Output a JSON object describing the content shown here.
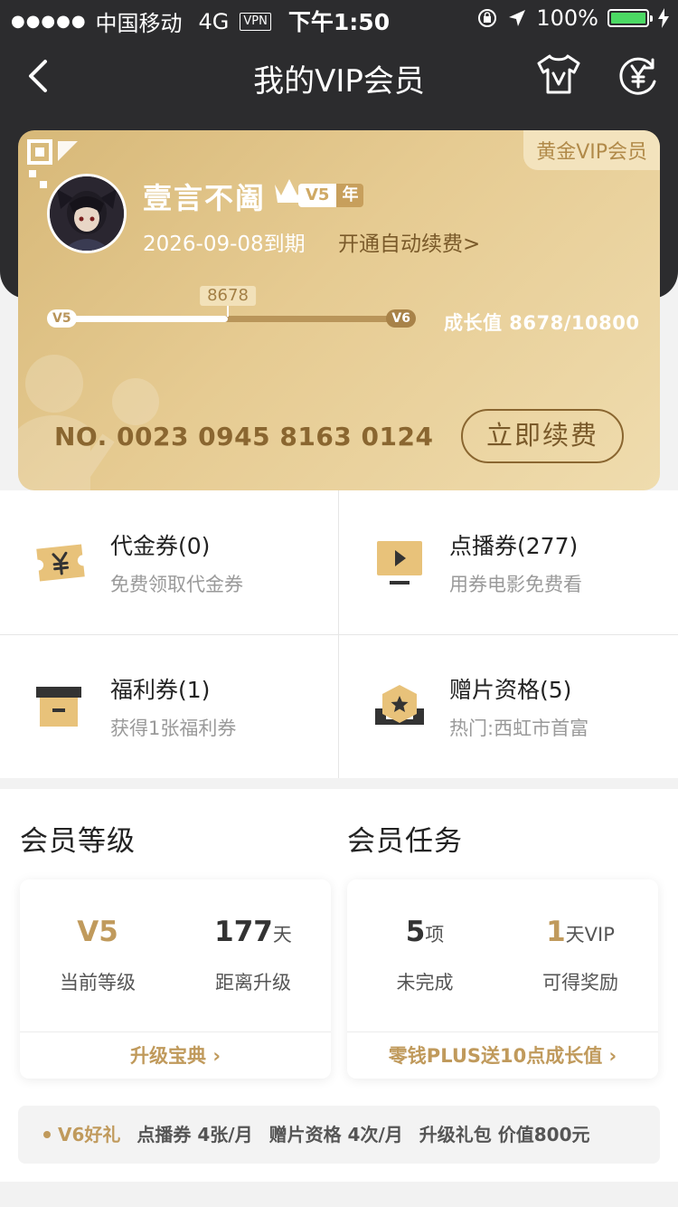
{
  "status_bar": {
    "signal_dots": "●●●●●",
    "carrier": "中国移动",
    "network": "4G",
    "vpn": "VPN",
    "time": "下午1:50",
    "battery": "100%"
  },
  "nav": {
    "title": "我的VIP会员",
    "icons": [
      "back-arrow-icon",
      "tshirt-icon",
      "yen-refresh-icon"
    ]
  },
  "card": {
    "tier_badge": "黄金VIP会员",
    "username": "壹言不阖",
    "level": "V5",
    "level_suffix": "年",
    "expire": "2026-09-08到期",
    "auto_renew": "开通自动续费>",
    "progress": {
      "current": 8678,
      "total": 10800,
      "current_label": "8678",
      "start_level": "V5",
      "end_level": "V6",
      "growth_text": "成长值 8678/10800"
    },
    "card_no": "NO. 0023 0945 8163 0124",
    "renew_button": "立即续费",
    "colors": {
      "gold_dark": "#8a6630",
      "gold": "#c09a5c"
    }
  },
  "benefits": [
    {
      "title": "代金券(0)",
      "subtitle": "免费领取代金券",
      "icon": "voucher-icon"
    },
    {
      "title": "点播券(277)",
      "subtitle": "用券电影免费看",
      "icon": "video-ticket-icon"
    },
    {
      "title": "福利券(1)",
      "subtitle": "获得1张福利券",
      "icon": "gift-box-icon"
    },
    {
      "title": "赠片资格(5)",
      "subtitle": "热门:西虹市首富",
      "icon": "star-badge-icon"
    }
  ],
  "member_level": {
    "title": "会员等级",
    "current_value": "V5",
    "current_label": "当前等级",
    "days_value": "177",
    "days_unit": "天",
    "days_label": "距离升级",
    "footer": "升级宝典 ›"
  },
  "member_task": {
    "title": "会员任务",
    "pending_value": "5",
    "pending_unit": "项",
    "pending_label": "未完成",
    "reward_value": "1",
    "reward_unit": "天VIP",
    "reward_label": "可得奖励",
    "footer": "零钱PLUS送10点成长值 ›"
  },
  "gift_bar": {
    "label": "V6好礼",
    "items": [
      "点播券 4张/月",
      "赠片资格 4次/月",
      "升级礼包 价值800元"
    ]
  }
}
